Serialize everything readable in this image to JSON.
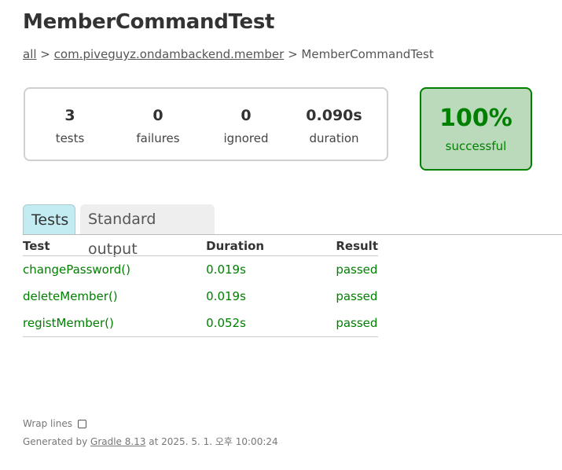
{
  "header": {
    "title": "MemberCommandTest"
  },
  "breadcrumb": {
    "all": "all",
    "sep1": " > ",
    "package": "com.piveguyz.ondambackend.member",
    "sep2": " > ",
    "current": "MemberCommandTest"
  },
  "summary": {
    "tests": {
      "value": "3",
      "label": "tests"
    },
    "failures": {
      "value": "0",
      "label": "failures"
    },
    "ignored": {
      "value": "0",
      "label": "ignored"
    },
    "duration": {
      "value": "0.090s",
      "label": "duration"
    },
    "success": {
      "value": "100%",
      "label": "successful"
    }
  },
  "tabs": [
    {
      "label": "Tests"
    },
    {
      "label": "Standard output"
    }
  ],
  "table": {
    "headers": [
      "Test",
      "Duration",
      "Result"
    ],
    "rows": [
      {
        "test": "changePassword()",
        "duration": "0.019s",
        "result": "passed"
      },
      {
        "test": "deleteMember()",
        "duration": "0.019s",
        "result": "passed"
      },
      {
        "test": "registMember()",
        "duration": "0.052s",
        "result": "passed"
      }
    ]
  },
  "footer": {
    "wrap_label": "Wrap lines",
    "generated_prefix": "Generated by ",
    "gradle_link": "Gradle 8.13",
    "generated_suffix": " at 2025. 5. 1. 오후 10:00:24"
  },
  "colors": {
    "success": "#008000",
    "success_bg": "#bbd9bb",
    "active_tab": "#c2ebf2"
  }
}
